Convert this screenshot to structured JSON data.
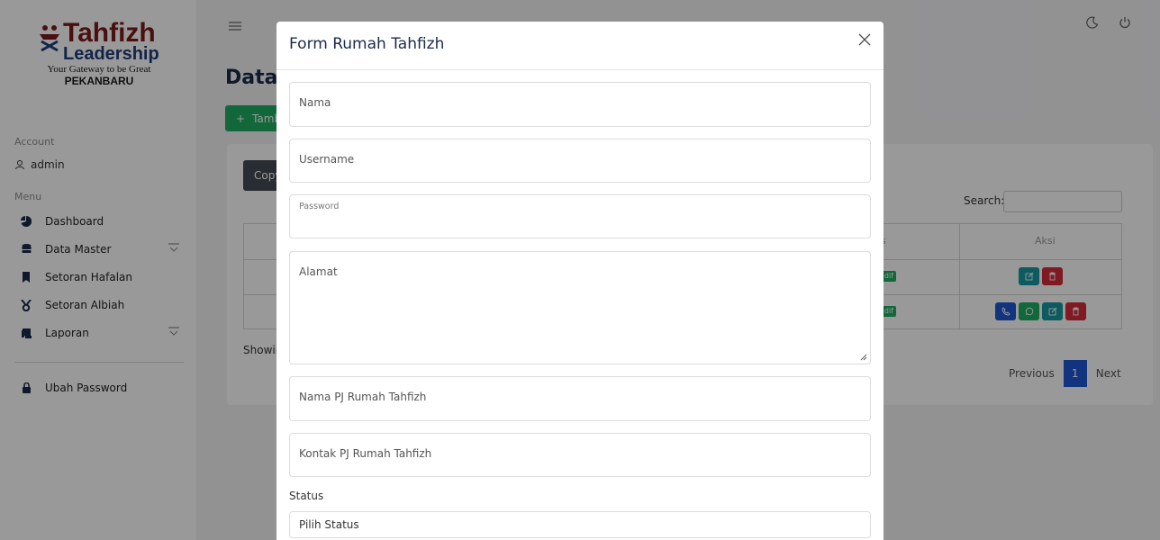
{
  "brand": {
    "name": "Tahfizh",
    "name_sub": "Leadership",
    "tagline": "Your Gateway to be Great",
    "city": "PEKANBARU"
  },
  "sidebar": {
    "account_heading": "Account",
    "user": "admin",
    "menu_heading": "Menu",
    "items": [
      {
        "label": "Dashboard",
        "icon": "pie-chart-icon"
      },
      {
        "label": "Data Master",
        "icon": "database-icon"
      },
      {
        "label": "Setoran Hafalan",
        "icon": "bookmark-icon"
      },
      {
        "label": "Setoran Albiah",
        "icon": "medal-icon"
      },
      {
        "label": "Laporan",
        "icon": "scroll-icon"
      }
    ],
    "change_password": "Ubah Password"
  },
  "page": {
    "title": "Data",
    "add_button": "Tamb",
    "copy_button": "Copy",
    "search_label": "Search:",
    "table_headers": {
      "status": "us",
      "actions": "Aksi"
    },
    "status_badge": "dif",
    "showing": "Showir",
    "pagination": {
      "previous": "Previous",
      "current": "1",
      "next": "Next"
    }
  },
  "modal": {
    "title": "Form Rumah Tahfizh",
    "fields": {
      "nama": "Nama",
      "username": "Username",
      "password": "Password",
      "alamat": "Alamat",
      "nama_pj": "Nama PJ Rumah Tahfizh",
      "kontak_pj": "Kontak PJ Rumah Tahfizh"
    },
    "status_label": "Status",
    "status_select": "Pilih Status"
  },
  "colors": {
    "primary": "#1f56d1",
    "success": "#1fae62",
    "danger": "#d42a3a",
    "info": "#1796a0",
    "dark": "#444c56",
    "brand_red": "#7c1a1a",
    "brand_blue": "#1f3d7a"
  }
}
